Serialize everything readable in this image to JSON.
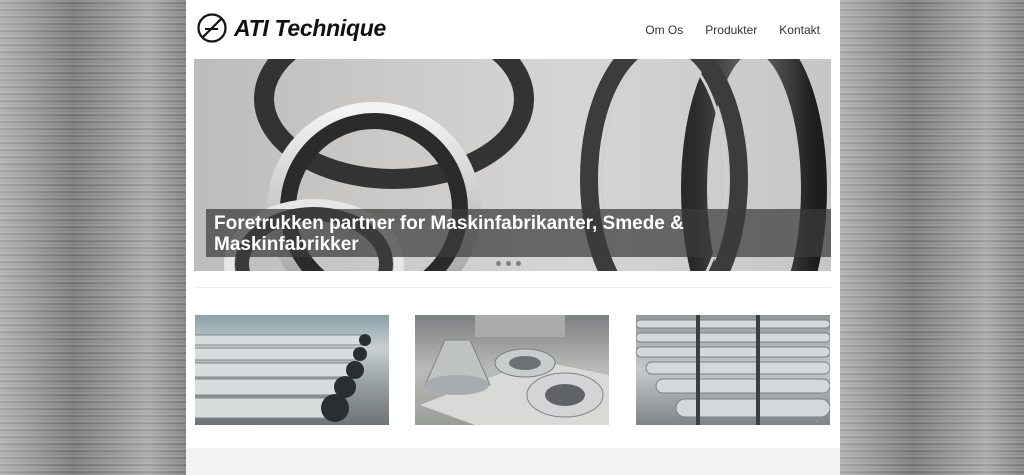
{
  "brand": {
    "name": "ATI Technique",
    "logo_icon": "circle-slash-logo-icon"
  },
  "nav": {
    "items": [
      "Om Os",
      "Produkter",
      "Kontakt"
    ]
  },
  "hero": {
    "caption": "Foretrukken partner for Maskinfabrikanter, Smede & Maskinfabrikker",
    "slide_count": 3
  },
  "thumbnails": [
    {
      "subject": "steel-rollers-photo"
    },
    {
      "subject": "forged-rings-photo"
    },
    {
      "subject": "forged-shafts-photo"
    }
  ],
  "colors": {
    "page_bg": "#ffffff",
    "caption_bg": "#3c3c3c",
    "text": "#111111"
  }
}
